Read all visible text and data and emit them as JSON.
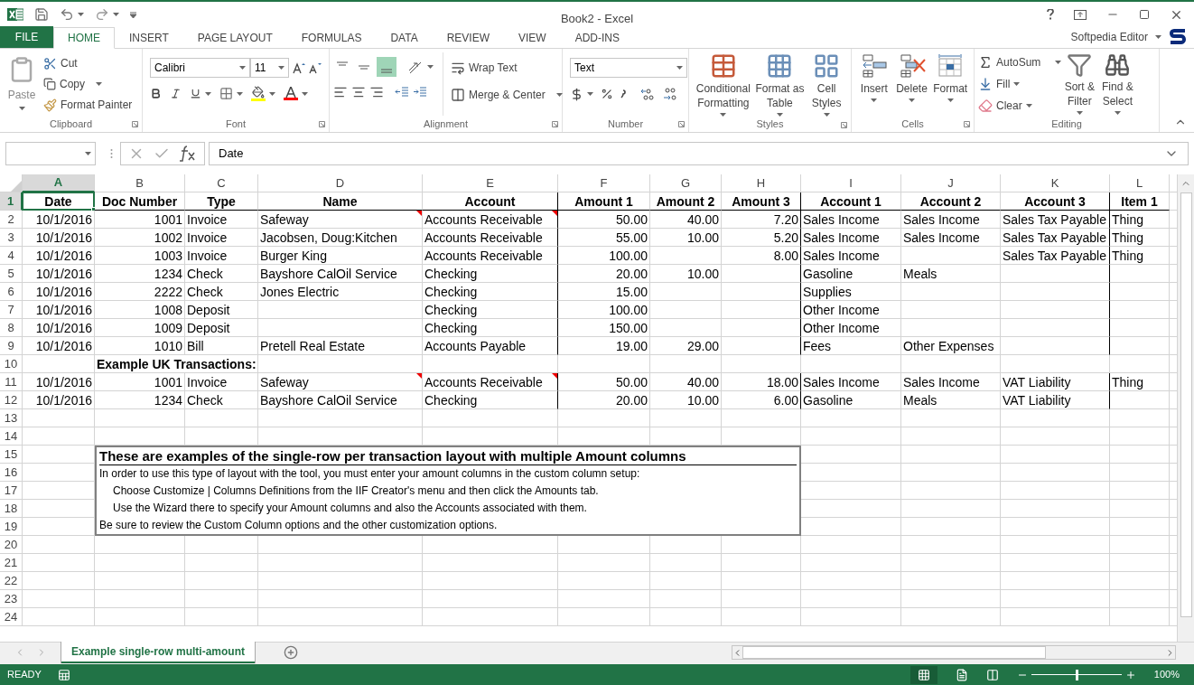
{
  "window": {
    "title": "Book2 - Excel"
  },
  "ribbon_tabs": [
    {
      "label": "FILE",
      "kind": "file",
      "selected": false
    },
    {
      "label": "HOME",
      "kind": "tab",
      "selected": true
    },
    {
      "label": "INSERT",
      "kind": "tab",
      "selected": false
    },
    {
      "label": "PAGE LAYOUT",
      "kind": "tab",
      "selected": false
    },
    {
      "label": "FORMULAS",
      "kind": "tab",
      "selected": false
    },
    {
      "label": "DATA",
      "kind": "tab",
      "selected": false
    },
    {
      "label": "REVIEW",
      "kind": "tab",
      "selected": false
    },
    {
      "label": "VIEW",
      "kind": "tab",
      "selected": false
    },
    {
      "label": "ADD-INS",
      "kind": "tab",
      "selected": false
    }
  ],
  "account": {
    "name": "Softpedia Editor"
  },
  "ribbon": {
    "clipboard": {
      "label": "Clipboard",
      "paste": "Paste",
      "cut": "Cut",
      "copy": "Copy",
      "format_painter": "Format Painter"
    },
    "font": {
      "label": "Font",
      "font_name": "Calibri",
      "font_size": "11"
    },
    "alignment": {
      "label": "Alignment",
      "wrap_text": "Wrap Text",
      "merge_center": "Merge & Center"
    },
    "number": {
      "label": "Number",
      "format": "Text"
    },
    "styles": {
      "label": "Styles",
      "conditional_formatting": "Conditional Formatting",
      "format_as_table": "Format as Table",
      "cell_styles": "Cell Styles"
    },
    "cells": {
      "label": "Cells",
      "insert": "Insert",
      "delete": "Delete",
      "format": "Format"
    },
    "editing": {
      "label": "Editing",
      "autosum": "AutoSum",
      "fill": "Fill",
      "clear": "Clear",
      "sort_filter": "Sort & Filter",
      "find_select": "Find & Select"
    }
  },
  "formula_bar": {
    "value": "Date"
  },
  "sheet": {
    "columns": [
      {
        "letter": "A",
        "numeric": true,
        "selected": true
      },
      {
        "letter": "B",
        "numeric": true,
        "selected": false
      },
      {
        "letter": "C",
        "numeric": false,
        "selected": false
      },
      {
        "letter": "D",
        "numeric": false,
        "selected": false
      },
      {
        "letter": "E",
        "numeric": false,
        "selected": false
      },
      {
        "letter": "F",
        "numeric": true,
        "selected": false
      },
      {
        "letter": "G",
        "numeric": true,
        "selected": false
      },
      {
        "letter": "H",
        "numeric": true,
        "selected": false
      },
      {
        "letter": "I",
        "numeric": false,
        "selected": false
      },
      {
        "letter": "J",
        "numeric": false,
        "selected": false
      },
      {
        "letter": "K",
        "numeric": false,
        "selected": false
      },
      {
        "letter": "L",
        "numeric": false,
        "selected": false
      }
    ],
    "rows": [
      {
        "number": "1",
        "kind": "header",
        "selected": true,
        "cells": {
          "A": "Date",
          "B": "Doc Number",
          "C": "Type",
          "D": "Name",
          "E": "Account",
          "F": "Amount 1",
          "G": "Amount 2",
          "H": "Amount 3",
          "I": "Account 1",
          "J": "Account 2",
          "K": "Account 3",
          "L": "Item 1"
        }
      },
      {
        "number": "2",
        "kind": "data",
        "selected": false,
        "name_comment": true,
        "account_comment": true,
        "cells": {
          "A": "10/1/2016",
          "B": "1001",
          "C": "Invoice",
          "D": "Safeway",
          "E": "Accounts Receivable",
          "F": "50.00",
          "G": "40.00",
          "H": "7.20",
          "I": "Sales Income",
          "J": "Sales Income",
          "K": "Sales Tax Payable",
          "L": "Thing"
        }
      },
      {
        "number": "3",
        "kind": "data",
        "selected": false,
        "cells": {
          "A": "10/1/2016",
          "B": "1002",
          "C": "Invoice",
          "D": "Jacobsen, Doug:Kitchen",
          "E": "Accounts Receivable",
          "F": "55.00",
          "G": "10.00",
          "H": "5.20",
          "I": "Sales Income",
          "J": "Sales Income",
          "K": "Sales Tax Payable",
          "L": "Thing"
        }
      },
      {
        "number": "4",
        "kind": "data",
        "selected": false,
        "cells": {
          "A": "10/1/2016",
          "B": "1003",
          "C": "Invoice",
          "D": "Burger King",
          "E": "Accounts Receivable",
          "F": "100.00",
          "H": "8.00",
          "I": "Sales Income",
          "K": "Sales Tax Payable",
          "L": "Thing"
        }
      },
      {
        "number": "5",
        "kind": "data",
        "selected": false,
        "cells": {
          "A": "10/1/2016",
          "B": "1234",
          "C": "Check",
          "D": "Bayshore CalOil Service",
          "E": "Checking",
          "F": "20.00",
          "G": "10.00",
          "I": "Gasoline",
          "J": "Meals"
        }
      },
      {
        "number": "6",
        "kind": "data",
        "selected": false,
        "cells": {
          "A": "10/1/2016",
          "B": "2222",
          "C": "Check",
          "D": "Jones Electric",
          "E": "Checking",
          "F": "15.00",
          "I": "Supplies"
        }
      },
      {
        "number": "7",
        "kind": "data",
        "selected": false,
        "cells": {
          "A": "10/1/2016",
          "B": "1008",
          "C": "Deposit",
          "E": "Checking",
          "F": "100.00",
          "I": "Other Income"
        }
      },
      {
        "number": "8",
        "kind": "data",
        "selected": false,
        "cells": {
          "A": "10/1/2016",
          "B": "1009",
          "C": "Deposit",
          "E": "Checking",
          "F": "150.00",
          "I": "Other Income"
        }
      },
      {
        "number": "9",
        "kind": "data",
        "selected": false,
        "cells": {
          "A": "10/1/2016",
          "B": "1010",
          "C": "Bill",
          "D": "Pretell Real Estate",
          "E": "Accounts Payable",
          "F": "19.00",
          "G": "29.00",
          "I": "Fees",
          "J": "Other Expenses"
        }
      },
      {
        "number": "10",
        "kind": "section",
        "selected": false,
        "cells": {
          "B": "Example UK Transactions:"
        }
      },
      {
        "number": "11",
        "kind": "data",
        "selected": false,
        "name_comment": true,
        "account_comment": true,
        "cells": {
          "A": "10/1/2016",
          "B": "1001",
          "C": "Invoice",
          "D": "Safeway",
          "E": "Accounts Receivable",
          "F": "50.00",
          "G": "40.00",
          "H": "18.00",
          "I": "Sales Income",
          "J": "Sales Income",
          "K": "VAT Liability",
          "L": "Thing"
        }
      },
      {
        "number": "12",
        "kind": "data",
        "selected": false,
        "cells": {
          "A": "10/1/2016",
          "B": "1234",
          "C": "Check",
          "D": "Bayshore CalOil Service",
          "E": "Checking",
          "F": "20.00",
          "G": "10.00",
          "H": "6.00",
          "I": "Gasoline",
          "J": "Meals",
          "K": "VAT Liability"
        }
      },
      {
        "number": "13",
        "kind": "empty",
        "selected": false
      },
      {
        "number": "14",
        "kind": "empty",
        "selected": false
      },
      {
        "number": "15",
        "kind": "empty",
        "selected": false
      },
      {
        "number": "16",
        "kind": "empty",
        "selected": false
      },
      {
        "number": "17",
        "kind": "empty",
        "selected": false
      },
      {
        "number": "18",
        "kind": "empty",
        "selected": false
      },
      {
        "number": "19",
        "kind": "empty",
        "selected": false
      },
      {
        "number": "20",
        "kind": "empty",
        "selected": false
      },
      {
        "number": "21",
        "kind": "empty",
        "selected": false
      },
      {
        "number": "22",
        "kind": "empty",
        "selected": false
      },
      {
        "number": "23",
        "kind": "empty",
        "selected": false
      },
      {
        "number": "24",
        "kind": "empty",
        "selected": false
      }
    ]
  },
  "text_box": {
    "title": "These are examples of the single-row per transaction layout with multiple Amount columns",
    "lines": [
      {
        "text": "In order to use this type of layout with the tool, you must enter your amount columns in the custom column setup:",
        "indented": false
      },
      {
        "text": "Choose Customize | Columns Definitions from the IIF Creator's menu and then click the Amounts tab.",
        "indented": true
      },
      {
        "text": "Use the Wizard there to specify your Amount columns and also the Accounts associated with them.",
        "indented": true
      },
      {
        "text": "Be sure to review the Custom Column options and the other customization options.",
        "indented": false
      }
    ]
  },
  "sheet_tabs": [
    {
      "label": "Example single-row multi-amount",
      "selected": true
    }
  ],
  "status_bar": {
    "mode": "READY",
    "zoom": "100%",
    "zoom_slider": {
      "level": 0.5
    }
  }
}
